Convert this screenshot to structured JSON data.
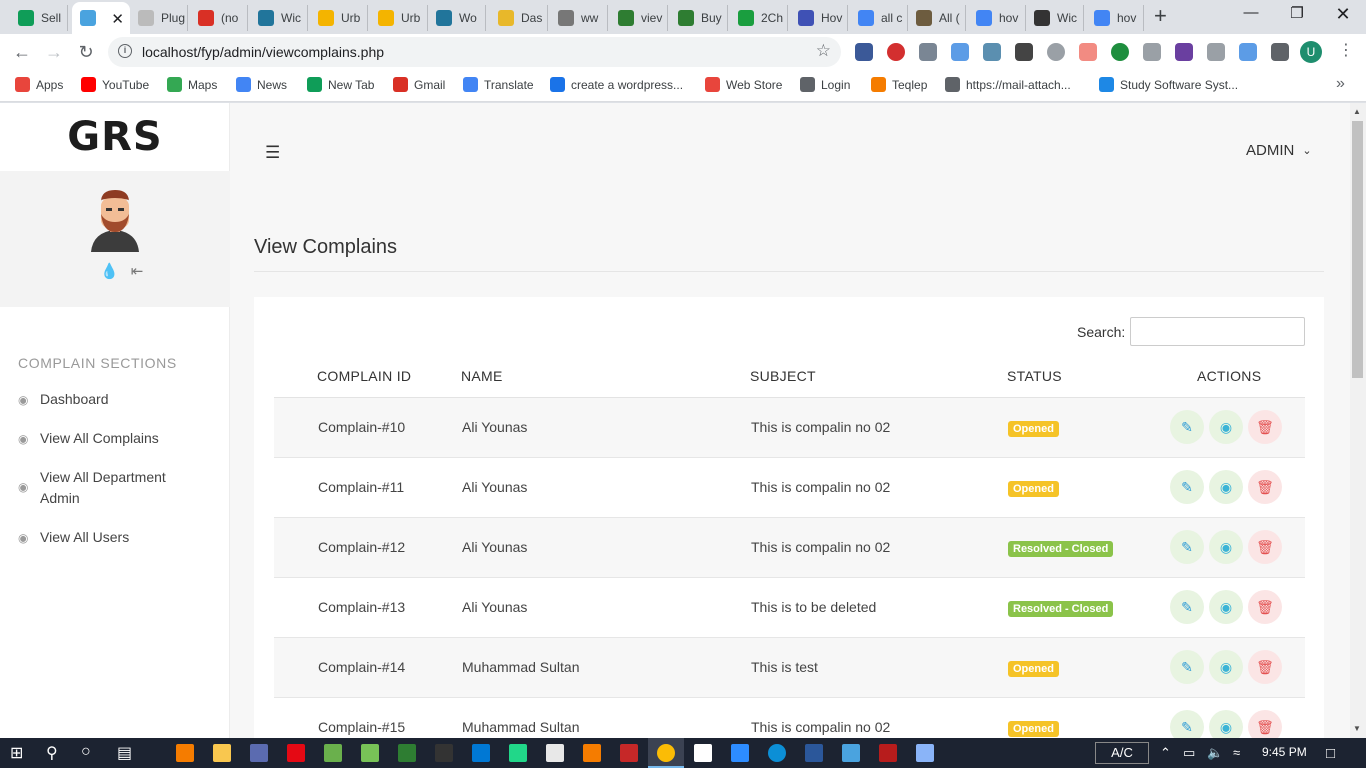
{
  "browser": {
    "tabs": [
      {
        "title": "Sell",
        "color": "#0f9d58"
      },
      {
        "title": "",
        "color": "#4aa3df",
        "active": true
      },
      {
        "title": "Plug",
        "color": "#bbbbbb"
      },
      {
        "title": "(no",
        "color": "#d93025"
      },
      {
        "title": "Wic",
        "color": "#21759b"
      },
      {
        "title": "Urb",
        "color": "#f4b400"
      },
      {
        "title": "Urb",
        "color": "#f4b400"
      },
      {
        "title": "Wo",
        "color": "#21759b"
      },
      {
        "title": "Das",
        "color": "#e8b82a"
      },
      {
        "title": "ww",
        "color": "#777777"
      },
      {
        "title": "viev",
        "color": "#2e7d32"
      },
      {
        "title": "Buy",
        "color": "#2e7d32"
      },
      {
        "title": "2Ch",
        "color": "#1a9e3f"
      },
      {
        "title": "Hov",
        "color": "#3f51b5"
      },
      {
        "title": "all c",
        "color": "#4285f4"
      },
      {
        "title": "All (",
        "color": "#6d5c3f"
      },
      {
        "title": "hov",
        "color": "#4285f4"
      },
      {
        "title": "Wic",
        "color": "#333333"
      },
      {
        "title": "hov",
        "color": "#4285f4"
      }
    ],
    "url": "localhost/fyp/admin/viewcomplains.php",
    "bookmarks": [
      {
        "label": "Apps",
        "color": "#e8453c"
      },
      {
        "label": "YouTube",
        "color": "#ff0000"
      },
      {
        "label": "Maps",
        "color": "#34a853"
      },
      {
        "label": "News",
        "color": "#4285f4"
      },
      {
        "label": "New Tab",
        "color": "#0f9d58"
      },
      {
        "label": "Gmail",
        "color": "#d93025"
      },
      {
        "label": "Translate",
        "color": "#4285f4"
      },
      {
        "label": "create a wordpress...",
        "color": "#1a73e8"
      },
      {
        "label": "Web Store",
        "color": "#e8453c"
      },
      {
        "label": "Login",
        "color": "#5f6368"
      },
      {
        "label": "Teqlep",
        "color": "#f57c00"
      },
      {
        "label": "https://mail-attach...",
        "color": "#5f6368"
      },
      {
        "label": "Study Software Syst...",
        "color": "#1e88e5"
      }
    ],
    "profile_initial": "U"
  },
  "sidebar": {
    "logo": "GRS",
    "section_title": "COMPLAIN SECTIONS",
    "items": [
      {
        "label": "Dashboard"
      },
      {
        "label": "View All Complains"
      },
      {
        "label": "View All Department Admin"
      },
      {
        "label": "View All Users"
      }
    ]
  },
  "header": {
    "user": "ADMIN"
  },
  "main": {
    "title": "View Complains",
    "search_label": "Search:",
    "columns": [
      "COMPLAIN ID",
      "NAME",
      "SUBJECT",
      "STATUS",
      "ACTIONS"
    ],
    "rows": [
      {
        "id": "Complain-#10",
        "name": "Ali Younas",
        "subject": "This is compalin no 02",
        "status": "Opened",
        "status_type": "opened"
      },
      {
        "id": "Complain-#11",
        "name": "Ali Younas",
        "subject": "This is compalin no 02",
        "status": "Opened",
        "status_type": "opened"
      },
      {
        "id": "Complain-#12",
        "name": "Ali Younas",
        "subject": "This is compalin no 02",
        "status": "Resolved - Closed",
        "status_type": "resolved"
      },
      {
        "id": "Complain-#13",
        "name": "Ali Younas",
        "subject": "This is to be deleted",
        "status": "Resolved - Closed",
        "status_type": "resolved"
      },
      {
        "id": "Complain-#14",
        "name": "Muhammad Sultan",
        "subject": "This is test",
        "status": "Opened",
        "status_type": "opened"
      },
      {
        "id": "Complain-#15",
        "name": "Muhammad Sultan",
        "subject": "This is compalin no 02",
        "status": "Opened",
        "status_type": "opened"
      }
    ]
  },
  "taskbar": {
    "ac_label": "A/C",
    "time": "9:45 PM"
  }
}
